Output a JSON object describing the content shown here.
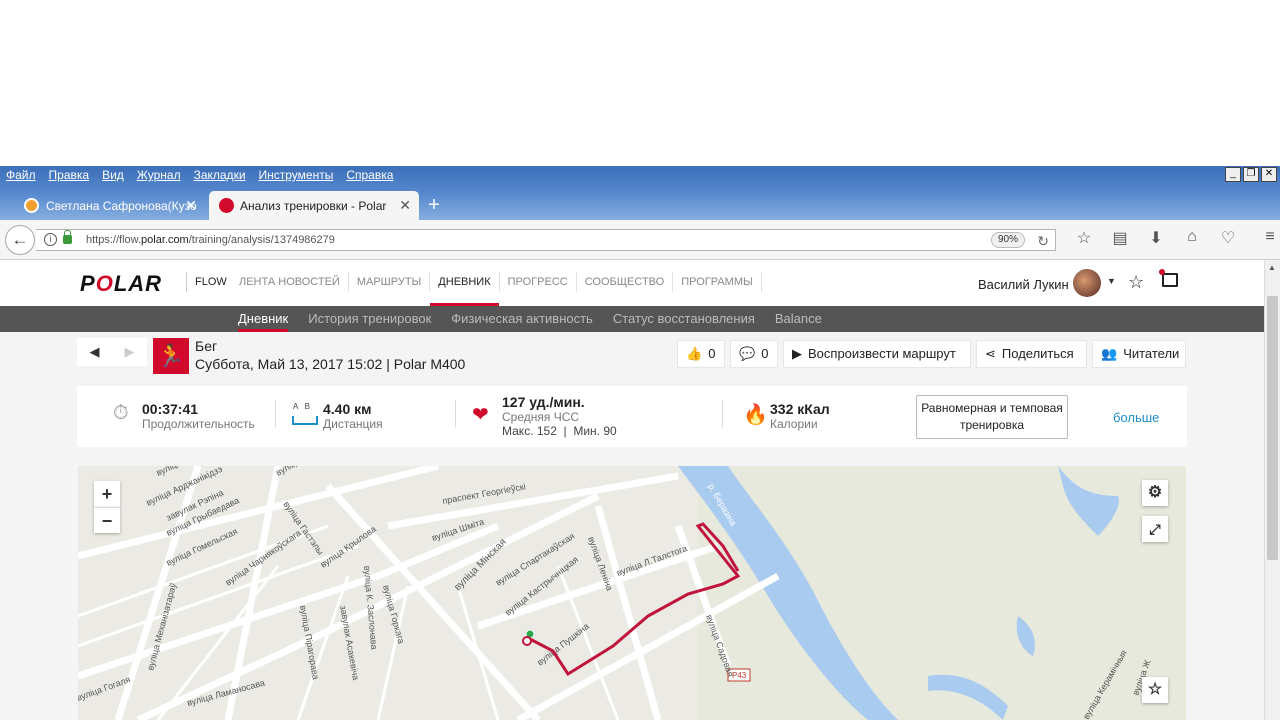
{
  "browser": {
    "menu": [
      "Файл",
      "Правка",
      "Вид",
      "Журнал",
      "Закладки",
      "Инструменты",
      "Справка"
    ],
    "tabs": [
      {
        "title": "Светлана Сафронова(Кузов...",
        "icon": "social-icon"
      },
      {
        "title": "Анализ тренировки - Polar F...",
        "icon": "polar-icon"
      }
    ],
    "url_prefix": "https://flow.",
    "url_domain": "polar.com",
    "url_path": "/training/analysis/1374986279",
    "zoom": "90%"
  },
  "header": {
    "logo": "POLAR",
    "flow": "FLOW",
    "nav": [
      "ЛЕНТА НОВОСТЕЙ",
      "МАРШРУТЫ",
      "ДНЕВНИК",
      "ПРОГРЕСС",
      "СООБЩЕСТВО",
      "ПРОГРАММЫ"
    ],
    "active_nav": "ДНЕВНИК",
    "user_name": "Василий Лукин"
  },
  "subnav": [
    "Дневник",
    "История тренировок",
    "Физическая активность",
    "Статус восстановления",
    "Balance"
  ],
  "session": {
    "sport": "Бег",
    "date": "Суббота, Май 13, 2017 15:02 | Polar M400",
    "likes": "0",
    "comments": "0",
    "replay_label": "Воспроизвести маршрут",
    "share_label": "Поделиться",
    "followers_label": "Читатели"
  },
  "stats": {
    "duration_value": "00:37:41",
    "duration_label": "Продолжительность",
    "distance_value": "4.40 км",
    "distance_label": "Дистанция",
    "distance_ab": "A   B",
    "hr_value": "127 уд./мин.",
    "hr_label": "Средняя ЧСС",
    "hr_sub": "Макс. 152  |  Мин. 90",
    "calories_value": "332 кКал",
    "calories_label": "Калории",
    "type_button": "Равномерная и темповая тренировка",
    "more": "больше"
  },
  "map": {
    "zoom_in": "+",
    "zoom_out": "−",
    "streets": [
      "праспект Георгіеўскі",
      "вуліца Мінская",
      "вуліца Крылова",
      "вуліца Ленiна",
      "вуліца Пушкіна",
      "вуліца Садовая",
      "вуліца Л.Талстога",
      "вуліца Спартакаўская",
      "вуліца Кастрычніцкая",
      "вуліца Шміта",
      "вуліца Гастэлы",
      "вуліца Грыбаедава",
      "вуліца Гомельская",
      "вуліца Чарнякоўскага",
      "вуліца Механізатараў",
      "вуліца Гогаля",
      "вуліца Ламаносава",
      "вуліца Пірагорава",
      "завулак Асакевіча",
      "вуліца Горкага",
      "вуліца К. Заслонава",
      "вуліца Арджанікідзэ",
      "завулак Рэпіна",
      "вуліца Рэпіна",
      "вуліца Праўсаюзу",
      "вуліца Керамічныя",
      "вуліца Ж",
      "р. Беразіна",
      "P43"
    ]
  }
}
